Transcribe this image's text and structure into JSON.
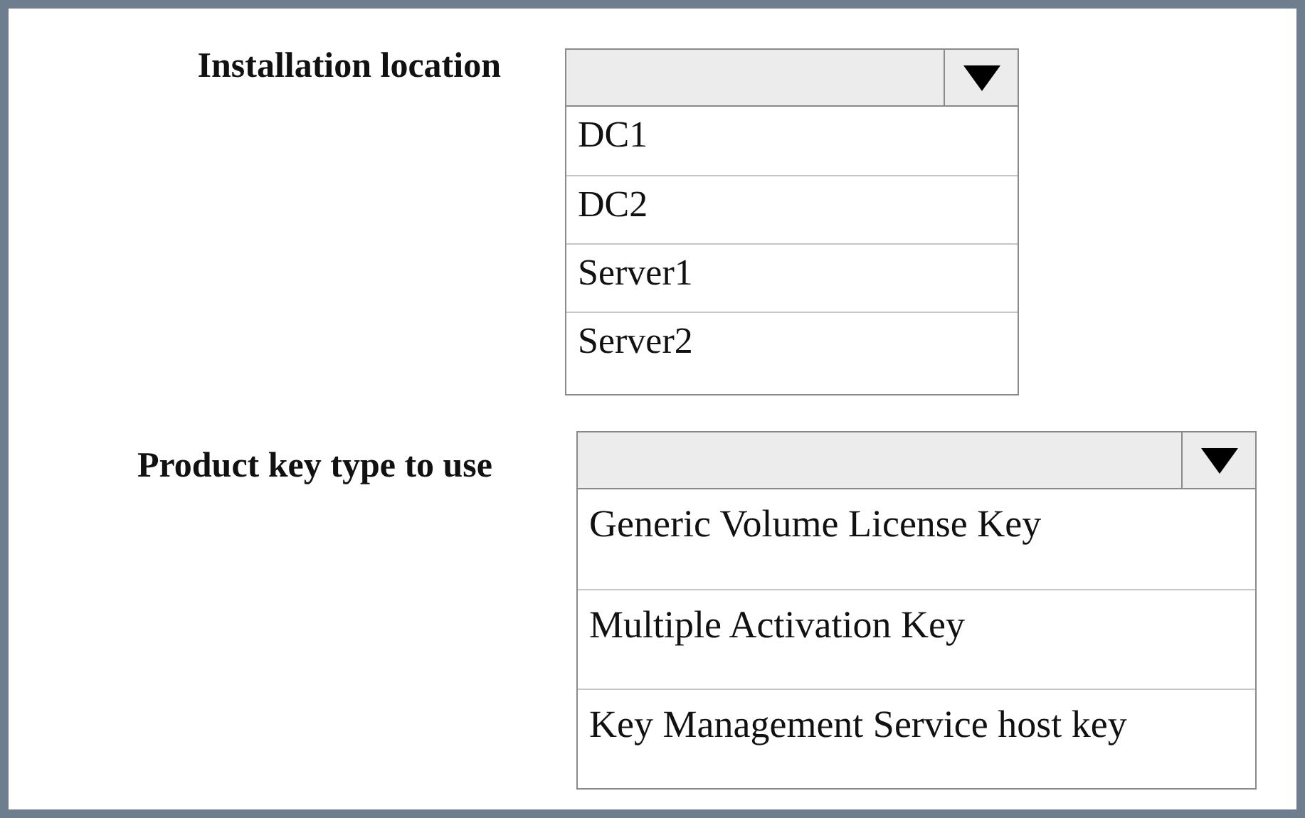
{
  "questions": [
    {
      "label": "Installation location",
      "options": [
        "DC1",
        "DC2",
        "Server1",
        "Server2"
      ]
    },
    {
      "label": "Product key type to use",
      "options": [
        "Generic Volume License Key",
        "Multiple Activation Key",
        "Key Management Service host key"
      ]
    }
  ]
}
